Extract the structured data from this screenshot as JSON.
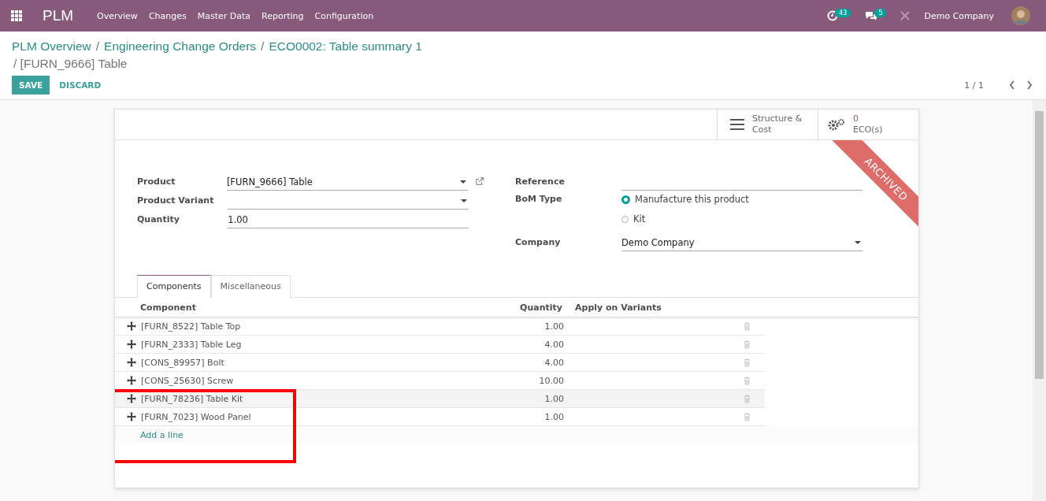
{
  "navbar": {
    "app_name": "PLM",
    "menu": [
      "Overview",
      "Changes",
      "Master Data",
      "Reporting",
      "Configuration"
    ],
    "activity_count": "43",
    "message_count": "5",
    "company": "Demo Company"
  },
  "breadcrumbs": [
    "PLM Overview",
    "Engineering Change Orders",
    "ECO0002: Table summary 1"
  ],
  "breadcrumb_separators": [
    "/",
    "/"
  ],
  "current": "/ [FURN_9666] Table",
  "buttons": {
    "save": "SAVE",
    "discard": "DISCARD"
  },
  "pager": {
    "value": "1 / 1"
  },
  "smart_buttons": [
    {
      "kind": "structure",
      "label": "Structure &\nCost"
    },
    {
      "kind": "eco",
      "count": "0",
      "label": "ECO(s)"
    }
  ],
  "ribbon": "ARCHIVED",
  "left_fields": [
    {
      "label": "Product",
      "value": "[FURN_9666] Table",
      "kind": "many2one",
      "external": true
    },
    {
      "label": "Product Variant",
      "kind": "many2one"
    },
    {
      "label": "Quantity",
      "value": "1.00",
      "kind": "text"
    }
  ],
  "reference": {
    "label": "Reference"
  },
  "bom_type": {
    "label": "BoM Type",
    "options": [
      {
        "label": "Manufacture this product",
        "selected": true
      },
      {
        "label": "Kit",
        "selected": false
      }
    ]
  },
  "company": {
    "label": "Company",
    "value": "Demo Company"
  },
  "tabs": [
    {
      "label": "Components",
      "selected": true
    },
    {
      "label": "Miscellaneous",
      "selected": false
    }
  ],
  "table": {
    "columns": [
      "Component",
      "Quantity",
      "Apply on Variants"
    ],
    "rows": [
      {
        "component": "[FURN_8522] Table Top",
        "quantity": "1.00",
        "selected": false
      },
      {
        "component": "[FURN_2333] Table Leg",
        "quantity": "4.00",
        "selected": false
      },
      {
        "component": "[CONS_89957] Bolt",
        "quantity": "4.00",
        "selected": false
      },
      {
        "component": "[CONS_25630] Screw",
        "quantity": "10.00",
        "selected": false
      },
      {
        "component": "[FURN_78236] Table Kit",
        "quantity": "1.00",
        "selected": true
      },
      {
        "component": "[FURN_7023] Wood Panel",
        "quantity": "1.00",
        "selected": false
      }
    ],
    "add_line": "Add a line"
  }
}
